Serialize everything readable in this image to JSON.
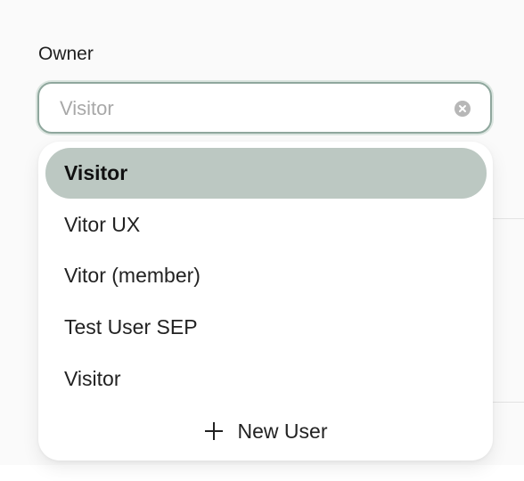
{
  "owner": {
    "label": "Owner",
    "placeholder": "Visitor"
  },
  "dropdown": {
    "options": [
      {
        "label": "Visitor",
        "selected": true
      },
      {
        "label": "Vitor UX",
        "selected": false
      },
      {
        "label": "Vitor (member)",
        "selected": false
      },
      {
        "label": "Test User SEP",
        "selected": false
      },
      {
        "label": "Visitor",
        "selected": false
      }
    ],
    "new_user_label": "New User"
  },
  "icons": {
    "clear": "clear-icon",
    "add": "plus-icon"
  },
  "colors": {
    "focus_border": "#8fa79d",
    "selected_option": "#bcc8c2",
    "clear_icon": "#b7b7b7"
  }
}
